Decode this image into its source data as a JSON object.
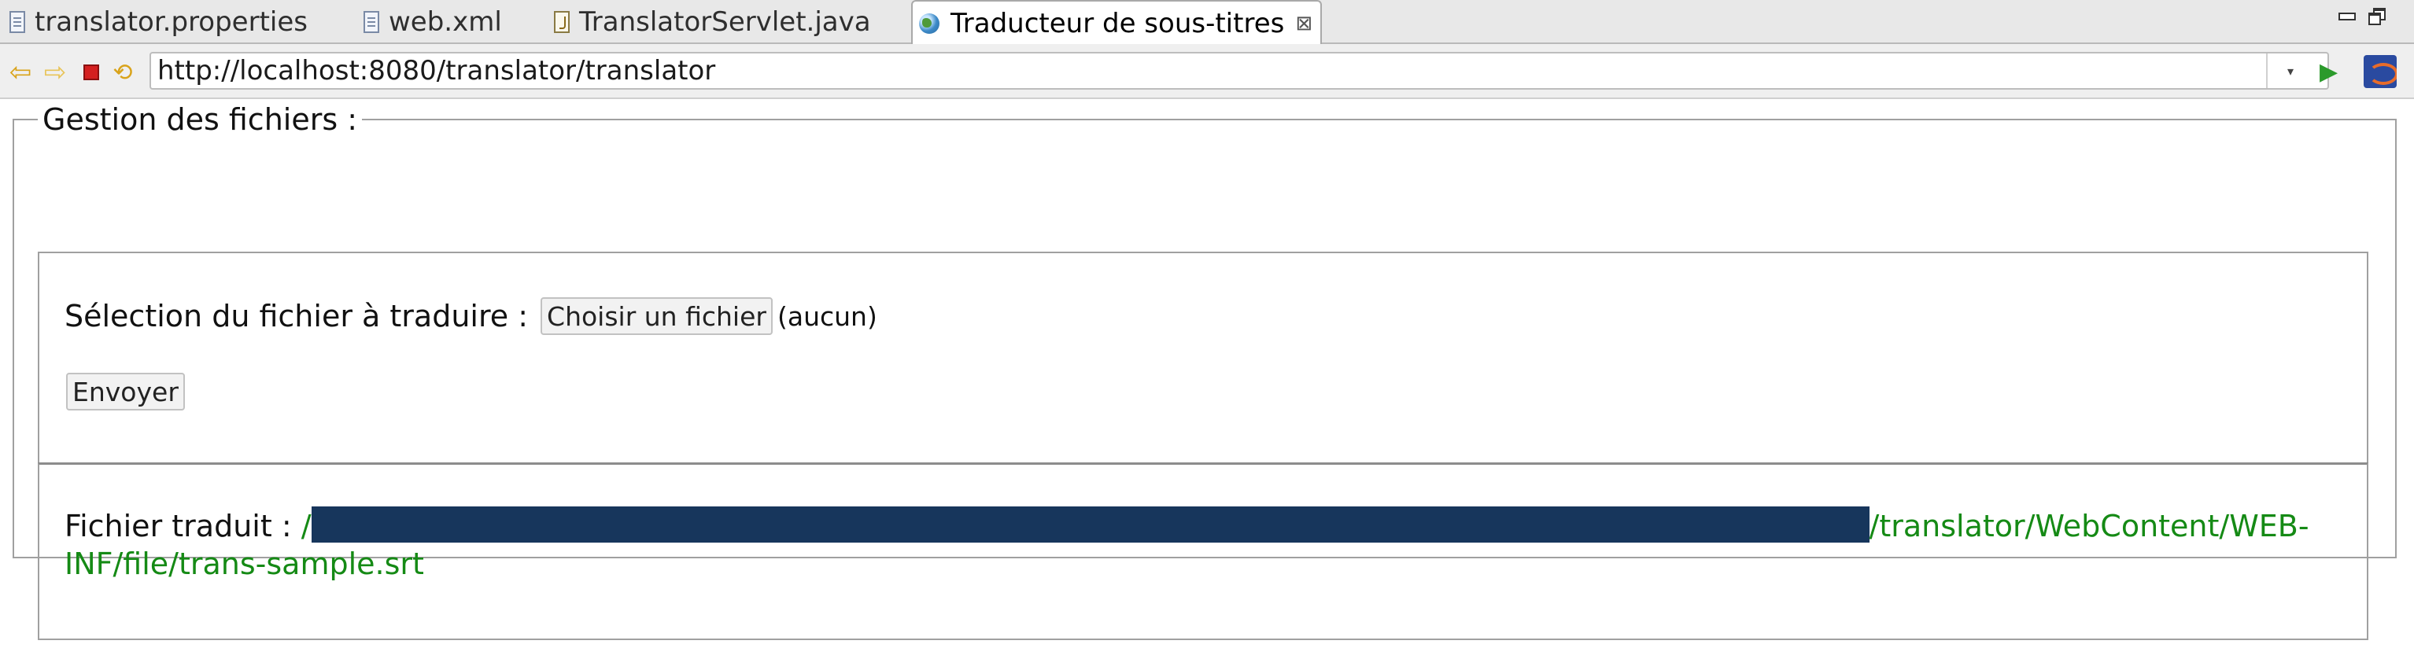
{
  "tabs": [
    {
      "label": "translator.properties",
      "icon": "properties-file-icon"
    },
    {
      "label": "web.xml",
      "icon": "xml-file-icon"
    },
    {
      "label": "TranslatorServlet.java",
      "icon": "java-file-icon"
    },
    {
      "label": "Traducteur de sous-titres",
      "icon": "globe-icon",
      "active": true
    }
  ],
  "tab_close_glyph": "⊠",
  "navbar": {
    "url": "http://localhost:8080/translator/translator",
    "dropdown_glyph": "▾",
    "go_glyph": "▶"
  },
  "page": {
    "legend": "Gestion des fichiers :",
    "select_label": "Sélection du fichier à traduire :",
    "choose_button": "Choisir un fichier",
    "no_file_text": "(aucun)",
    "submit_button": "Envoyer",
    "result_label": "Fichier traduit :",
    "result_path_prefix": "/",
    "result_path": "/translator/WebContent/WEB-INF/file/trans-sample.srt"
  },
  "colors": {
    "path_text": "#158a15",
    "redaction": "#17365c"
  }
}
